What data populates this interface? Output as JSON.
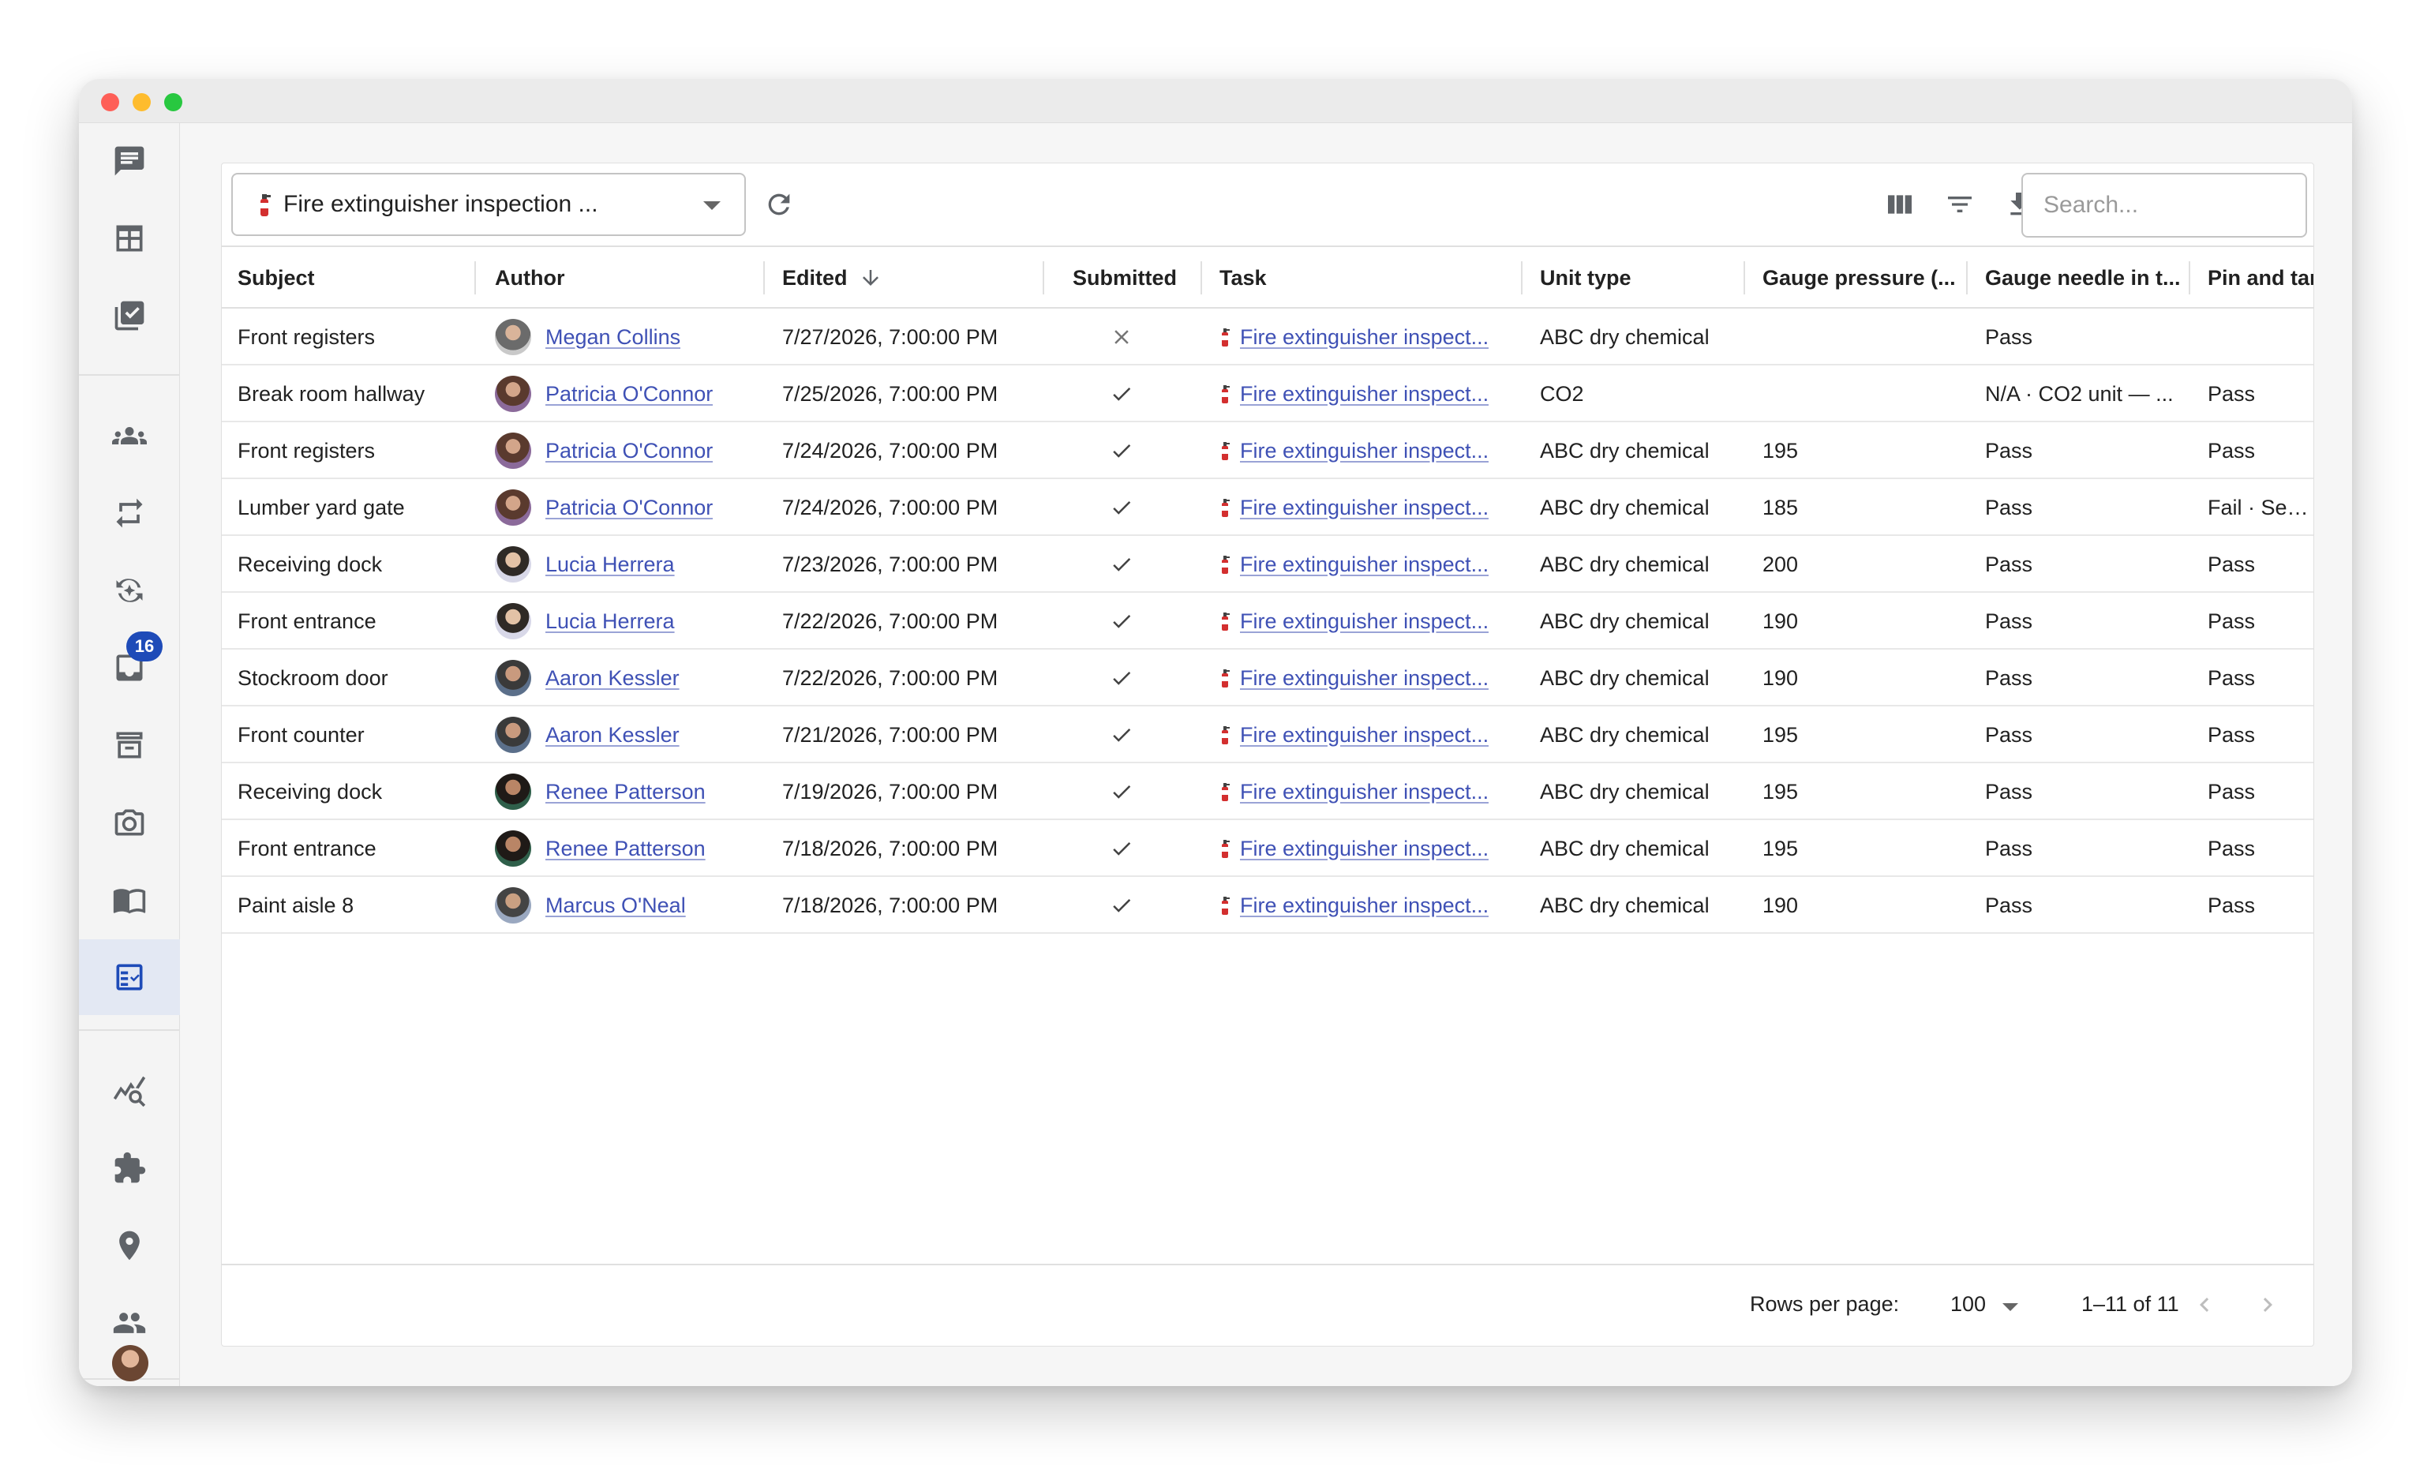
{
  "app": {
    "selector_value": "Fire extinguisher inspection ...",
    "search_placeholder": "Search...",
    "nav_badge": "16"
  },
  "columns": {
    "subject": "Subject",
    "author": "Author",
    "edited": "Edited",
    "submitted": "Submitted",
    "task": "Task",
    "unit_type": "Unit type",
    "gauge_pressure": "Gauge pressure (...",
    "gauge_needle": "Gauge needle in t...",
    "pin_tamper": "Pin and tampe"
  },
  "rows": [
    {
      "subject": "Front registers",
      "author": "Megan Collins",
      "edited": "7/27/2026, 7:00:00 PM",
      "submitted": "no",
      "task": "Fire extinguisher inspect...",
      "unit_type": "ABC dry chemical",
      "gauge_pressure": "",
      "gauge_needle": "Pass",
      "pin_tamper": ""
    },
    {
      "subject": "Break room hallway",
      "author": "Patricia O'Connor",
      "edited": "7/25/2026, 7:00:00 PM",
      "submitted": "yes",
      "task": "Fire extinguisher inspect...",
      "unit_type": "CO2",
      "gauge_pressure": "",
      "gauge_needle": "N/A · CO2 unit — ...",
      "pin_tamper": "Pass"
    },
    {
      "subject": "Front registers",
      "author": "Patricia O'Connor",
      "edited": "7/24/2026, 7:00:00 PM",
      "submitted": "yes",
      "task": "Fire extinguisher inspect...",
      "unit_type": "ABC dry chemical",
      "gauge_pressure": "195",
      "gauge_needle": "Pass",
      "pin_tamper": "Pass"
    },
    {
      "subject": "Lumber yard gate",
      "author": "Patricia O'Connor",
      "edited": "7/24/2026, 7:00:00 PM",
      "submitted": "yes",
      "task": "Fire extinguisher inspect...",
      "unit_type": "ABC dry chemical",
      "gauge_pressure": "185",
      "gauge_needle": "Pass",
      "pin_tamper": "Fail · Seal sna"
    },
    {
      "subject": "Receiving dock",
      "author": "Lucia Herrera",
      "edited": "7/23/2026, 7:00:00 PM",
      "submitted": "yes",
      "task": "Fire extinguisher inspect...",
      "unit_type": "ABC dry chemical",
      "gauge_pressure": "200",
      "gauge_needle": "Pass",
      "pin_tamper": "Pass"
    },
    {
      "subject": "Front entrance",
      "author": "Lucia Herrera",
      "edited": "7/22/2026, 7:00:00 PM",
      "submitted": "yes",
      "task": "Fire extinguisher inspect...",
      "unit_type": "ABC dry chemical",
      "gauge_pressure": "190",
      "gauge_needle": "Pass",
      "pin_tamper": "Pass"
    },
    {
      "subject": "Stockroom door",
      "author": "Aaron Kessler",
      "edited": "7/22/2026, 7:00:00 PM",
      "submitted": "yes",
      "task": "Fire extinguisher inspect...",
      "unit_type": "ABC dry chemical",
      "gauge_pressure": "190",
      "gauge_needle": "Pass",
      "pin_tamper": "Pass"
    },
    {
      "subject": "Front counter",
      "author": "Aaron Kessler",
      "edited": "7/21/2026, 7:00:00 PM",
      "submitted": "yes",
      "task": "Fire extinguisher inspect...",
      "unit_type": "ABC dry chemical",
      "gauge_pressure": "195",
      "gauge_needle": "Pass",
      "pin_tamper": "Pass"
    },
    {
      "subject": "Receiving dock",
      "author": "Renee Patterson",
      "edited": "7/19/2026, 7:00:00 PM",
      "submitted": "yes",
      "task": "Fire extinguisher inspect...",
      "unit_type": "ABC dry chemical",
      "gauge_pressure": "195",
      "gauge_needle": "Pass",
      "pin_tamper": "Pass"
    },
    {
      "subject": "Front entrance",
      "author": "Renee Patterson",
      "edited": "7/18/2026, 7:00:00 PM",
      "submitted": "yes",
      "task": "Fire extinguisher inspect...",
      "unit_type": "ABC dry chemical",
      "gauge_pressure": "195",
      "gauge_needle": "Pass",
      "pin_tamper": "Pass"
    },
    {
      "subject": "Paint aisle 8",
      "author": "Marcus O'Neal",
      "edited": "7/18/2026, 7:00:00 PM",
      "submitted": "yes",
      "task": "Fire extinguisher inspect...",
      "unit_type": "ABC dry chemical",
      "gauge_pressure": "190",
      "gauge_needle": "Pass",
      "pin_tamper": "Pass"
    }
  ],
  "footer": {
    "rows_per_page_label": "Rows per page:",
    "rows_per_page_value": "100",
    "range_label": "1–11 of 11"
  },
  "colors": {
    "accent": "#1e4bb8",
    "link": "#3f51b5",
    "active_nav_bg": "#e3e8f3"
  }
}
